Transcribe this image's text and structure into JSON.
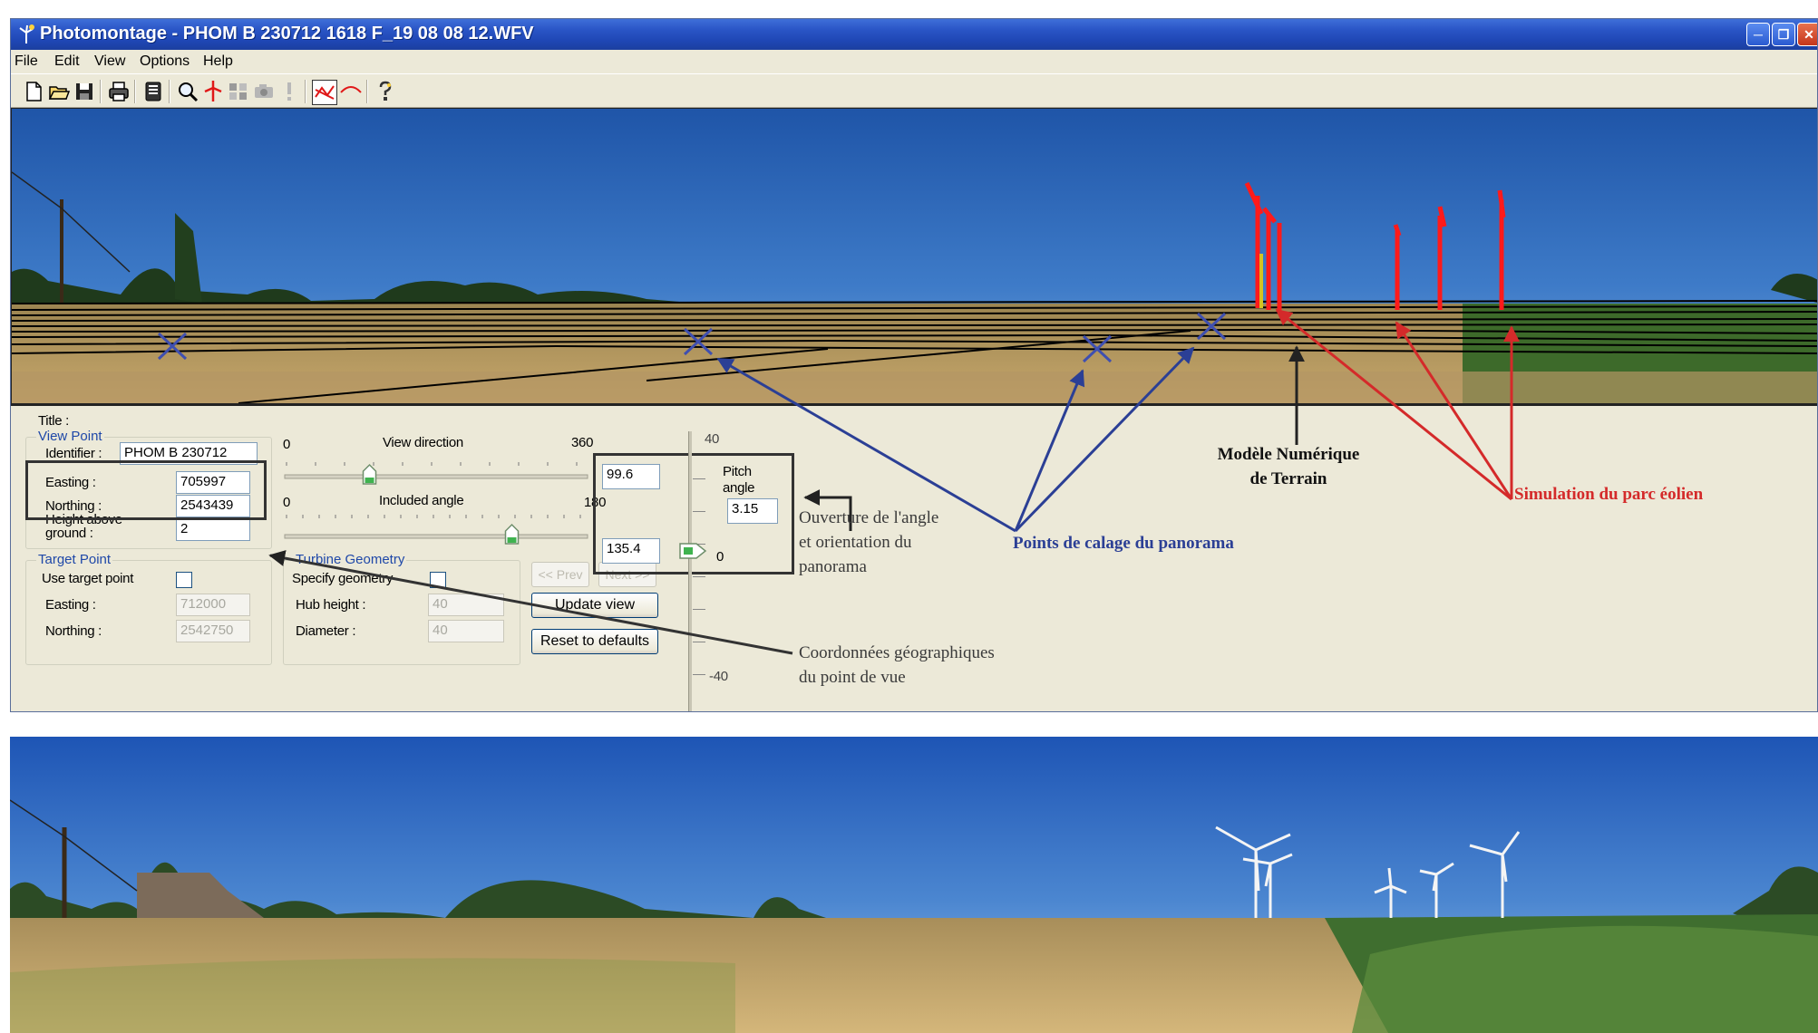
{
  "window": {
    "title": "Photomontage - PHOM B 230712 1618 F_19 08 08 12.WFV",
    "controls": [
      "minimize",
      "restore",
      "close"
    ]
  },
  "menu": [
    "File",
    "Edit",
    "View",
    "Options",
    "Help"
  ],
  "toolbar_icons": [
    "new-file-icon",
    "open-folder-icon",
    "save-icon",
    "print-icon",
    "document-icon",
    "zoom-icon",
    "turbine-icon",
    "layout-icon",
    "camera-icon",
    "exclamation-icon",
    "wireframe-icon",
    "terrain-curve-icon",
    "help-icon"
  ],
  "panel": {
    "title_label": "Title :",
    "view_point": {
      "caption": "View Point",
      "identifier_label": "Identifier :",
      "identifier_value": "PHOM B 230712",
      "easting_label": "Easting :",
      "easting_value": "705997",
      "northing_label": "Northing :",
      "northing_value": "2543439",
      "height_label_1": "Height above",
      "height_label_2": "ground :",
      "height_value": "2"
    },
    "target_point": {
      "caption": "Target Point",
      "use_label": "Use target point",
      "use_checked": false,
      "easting_label": "Easting :",
      "easting_value": "712000",
      "northing_label": "Northing :",
      "northing_value": "2542750"
    },
    "view_direction": {
      "label": "View direction",
      "min": "0",
      "max": "360",
      "value": "99.6",
      "fraction": 0.28
    },
    "included_angle": {
      "label": "Included angle",
      "min": "0",
      "max": "180",
      "value": "135.4",
      "fraction": 0.75
    },
    "turbine_geometry": {
      "caption": "Turbine Geometry",
      "specify_label": "Specify geometry",
      "specify_checked": false,
      "hub_label": "Hub height :",
      "hub_value": "40",
      "diameter_label": "Diameter :",
      "diameter_value": "40"
    },
    "buttons": {
      "prev": "<< Prev",
      "next": "Next >>",
      "update": "Update view",
      "reset": "Reset to defaults"
    },
    "pitch": {
      "label_1": "Pitch",
      "label_2": "angle",
      "value": "3.15",
      "top": "40",
      "zero": "0",
      "bottom": "-40"
    }
  },
  "annotations": {
    "ouverture": [
      "Ouverture de l'angle",
      "et orientation du",
      "panorama"
    ],
    "coordonnees": [
      "Coordonnées géographiques",
      "du point de vue"
    ],
    "points": "Points de calage du panorama",
    "modele": [
      "Modèle Numérique",
      "de Terrain"
    ],
    "simulation": "Simulation du parc éolien"
  },
  "colors": {
    "annotation_blue": "#2b3f95",
    "annotation_red": "#d42a2a",
    "annotation_black": "#222222",
    "turbine_red": "#ff1a1a",
    "title_bar": "#2a55c6"
  }
}
